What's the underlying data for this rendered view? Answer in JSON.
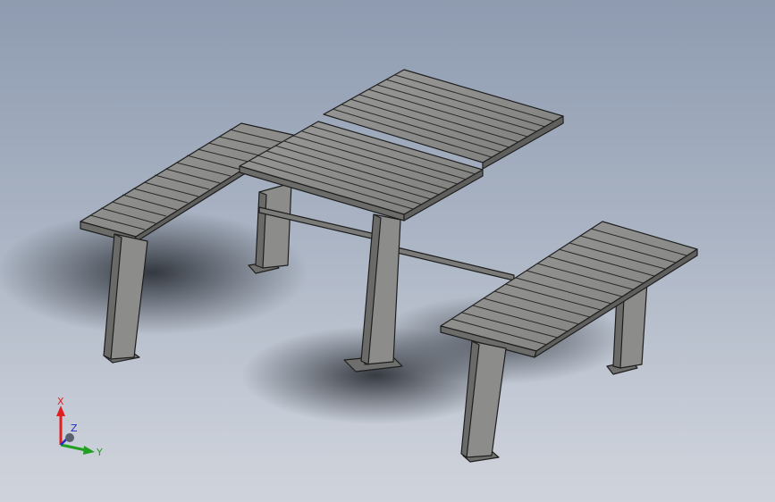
{
  "viewport": {
    "background_top": "#8e9bb0",
    "background_bottom": "#cfd3db"
  },
  "model": {
    "part_color": "#8a8a88",
    "edge_color": "#1e1e1e"
  },
  "triad": {
    "x_label": "X",
    "y_label": "Y",
    "z_label": "Z",
    "x_color": "#e02020",
    "y_color": "#20a020",
    "z_color": "#2030c0"
  }
}
